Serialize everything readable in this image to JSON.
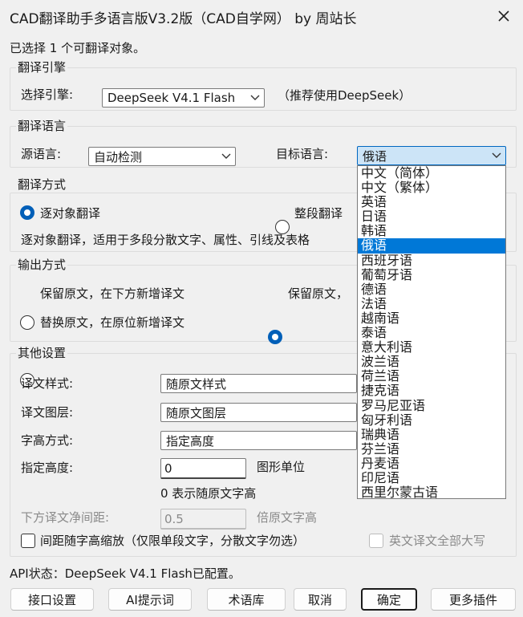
{
  "window": {
    "title": "CAD翻译助手多语言版V3.2版（CAD自学网） by 周站长"
  },
  "status_top": "已选择 1 个可翻译对象。",
  "engine": {
    "group_title": "翻译引擎",
    "label": "选择引擎:",
    "value": "DeepSeek V4.1 Flash",
    "hint": "（推荐使用DeepSeek）"
  },
  "language": {
    "group_title": "翻译语言",
    "source_label": "源语言:",
    "source_value": "自动检测",
    "target_label": "目标语言:",
    "target_value": "俄语",
    "options": [
      "中文（简体）",
      "中文（繁体）",
      "英语",
      "日语",
      "韩语",
      "俄语",
      "西班牙语",
      "葡萄牙语",
      "德语",
      "法语",
      "越南语",
      "泰语",
      "意大利语",
      "波兰语",
      "荷兰语",
      "捷克语",
      "罗马尼亚语",
      "匈牙利语",
      "瑞典语",
      "芬兰语",
      "丹麦语",
      "印尼语",
      "西里尔蒙古语"
    ],
    "selected_index": 5
  },
  "mode": {
    "group_title": "翻译方式",
    "option_1": "逐对象翻译",
    "option_2": "整段翻译",
    "desc": "逐对象翻译，适用于多段分散文字、属性、引线及表格"
  },
  "output": {
    "group_title": "输出方式",
    "option_1": "保留原文，在下方新增译文",
    "option_2": "保留原文，",
    "option_3": "替换原文，在原位新增译文"
  },
  "other": {
    "group_title": "其他设置",
    "style_label": "译文样式:",
    "style_value": "随原文样式",
    "layer_label": "译文图层:",
    "layer_value": "随原文图层",
    "height_mode_label": "字高方式:",
    "height_mode_value": "指定高度",
    "height_label": "指定高度:",
    "height_value": "0",
    "height_unit": "图形单位",
    "height_hint": "0 表示随原文字高",
    "spacing_label": "下方译文净间距:",
    "spacing_value": "0.5",
    "spacing_unit": "倍原文字高",
    "scale_check": "间距随字高缩放（仅限单段文字，分散文字勿选）",
    "upper_check": "英文译文全部大写"
  },
  "api_status": "API状态：DeepSeek V4.1 Flash已配置。",
  "buttons": {
    "interface": "接口设置",
    "ai_prompt": "AI提示词",
    "glossary": "术语库",
    "cancel": "取消",
    "ok": "确定",
    "more": "更多插件"
  },
  "colors": {
    "accent": "#005fb8",
    "selection": "#0078d7"
  }
}
